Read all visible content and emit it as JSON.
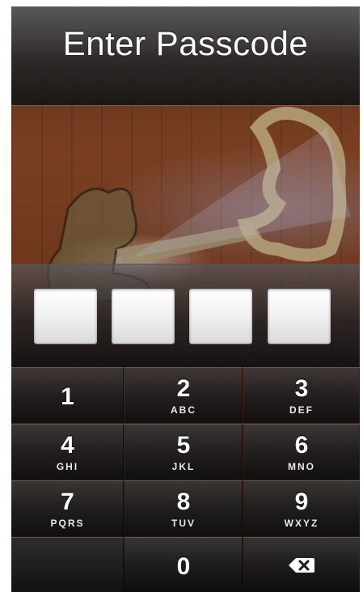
{
  "header": {
    "title": "Enter Passcode"
  },
  "passcode": {
    "length": 4,
    "entered": 0
  },
  "keypad": {
    "keys": [
      {
        "digit": "1",
        "letters": ""
      },
      {
        "digit": "2",
        "letters": "ABC"
      },
      {
        "digit": "3",
        "letters": "DEF"
      },
      {
        "digit": "4",
        "letters": "GHI"
      },
      {
        "digit": "5",
        "letters": "JKL"
      },
      {
        "digit": "6",
        "letters": "MNO"
      },
      {
        "digit": "7",
        "letters": "PQRS"
      },
      {
        "digit": "8",
        "letters": "TUV"
      },
      {
        "digit": "9",
        "letters": "WXYZ"
      },
      {
        "digit": "0",
        "letters": ""
      }
    ],
    "delete_icon": "backspace-icon"
  },
  "wallpaper": {
    "subject": "antique key in door lock"
  },
  "colors": {
    "box_fill": "#f1f1f1",
    "key_text": "#ffffff",
    "header_text": "#ffffff"
  }
}
